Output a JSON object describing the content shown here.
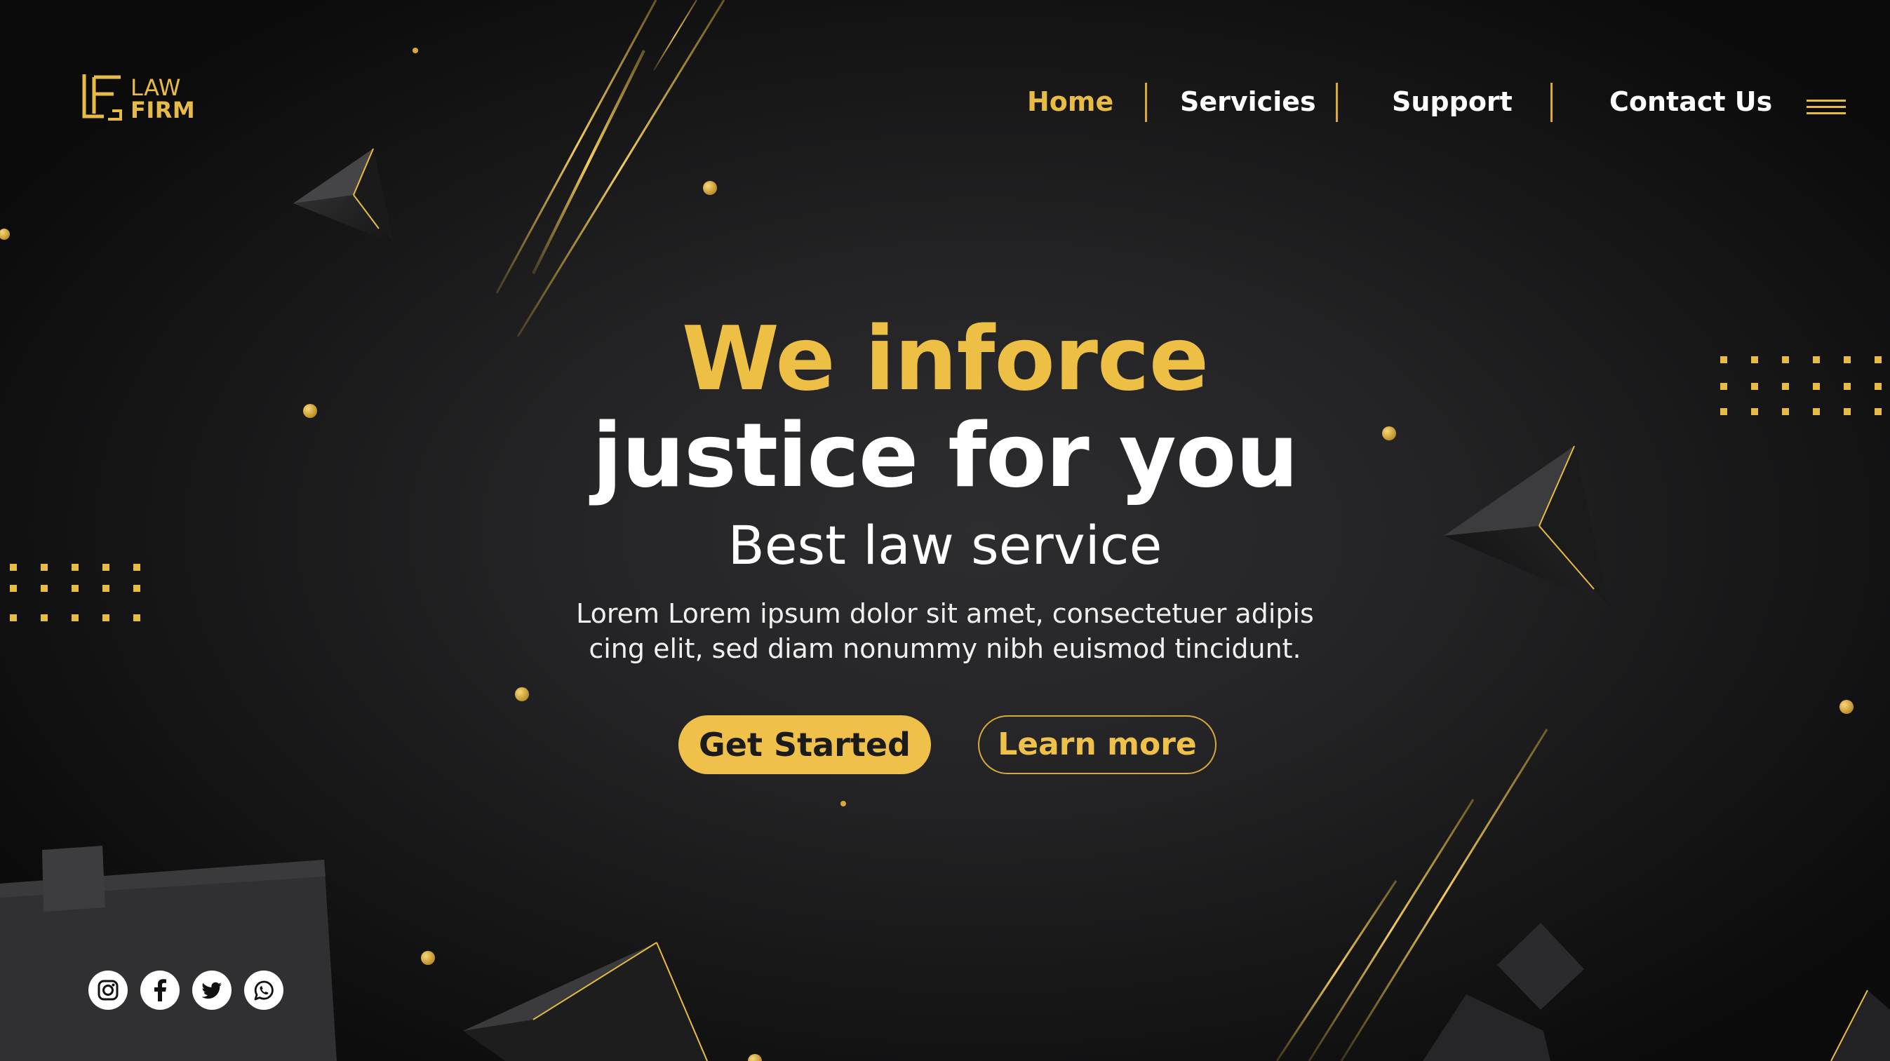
{
  "brand": {
    "monogram": "LF",
    "line1": "LAW",
    "line2": "FIRM",
    "accent_color": "#e8bb45"
  },
  "nav": {
    "items": [
      {
        "label": "Home",
        "active": true
      },
      {
        "label": "Servicies",
        "active": false
      },
      {
        "label": "Support",
        "active": false
      },
      {
        "label": "Contact Us",
        "active": false
      }
    ],
    "menu_icon": "hamburger-icon"
  },
  "hero": {
    "headline_line1": "We inforce",
    "headline_line2": "justice for you",
    "subheadline": "Best law service",
    "body_line1": "Lorem Lorem ipsum dolor sit amet, consectetuer adipis",
    "body_line2": "cing elit, sed diam nonummy nibh euismod tincidunt.",
    "primary_button": "Get Started",
    "secondary_button": "Learn more"
  },
  "social": [
    {
      "icon": "instagram-icon"
    },
    {
      "icon": "facebook-icon"
    },
    {
      "icon": "twitter-icon"
    },
    {
      "icon": "whatsapp-icon"
    }
  ],
  "colors": {
    "background": "#1c1c1e",
    "gold": "#efc14a",
    "text": "#ffffff"
  }
}
